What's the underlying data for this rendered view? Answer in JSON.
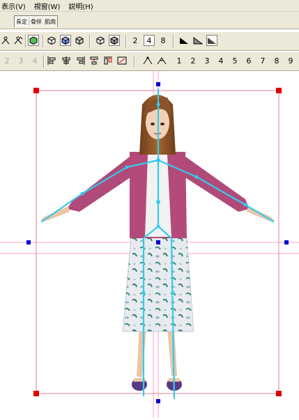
{
  "menu": {
    "view": "表示(V)",
    "window": "視窗(W)",
    "help": "説明(H)"
  },
  "tabs": [
    {
      "label": "長定"
    },
    {
      "label": "骨伴"
    },
    {
      "label": "肌肉"
    }
  ],
  "toolbar1": {
    "num2": "2",
    "num4": "4",
    "num8": "8"
  },
  "toolbar2": {
    "dim_nums": [
      "2",
      "3",
      "4"
    ],
    "nums": [
      "1",
      "2",
      "3",
      "4",
      "5",
      "6",
      "7",
      "8",
      "9"
    ]
  },
  "colors": {
    "chrome": "#ece9d8",
    "handle_red": "#e00000",
    "handle_blue": "#0000d0",
    "bone": "#33ccee",
    "guide": "#ff9ec8"
  }
}
